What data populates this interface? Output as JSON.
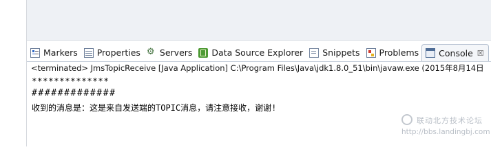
{
  "tabs": [
    {
      "label": "Markers",
      "icon": "markers-icon"
    },
    {
      "label": "Properties",
      "icon": "properties-icon"
    },
    {
      "label": "Servers",
      "icon": "servers-icon"
    },
    {
      "label": "Data Source Explorer",
      "icon": "data-source-explorer-icon"
    },
    {
      "label": "Snippets",
      "icon": "snippets-icon"
    },
    {
      "label": "Problems",
      "icon": "problems-icon"
    },
    {
      "label": "Console",
      "icon": "console-icon",
      "active": true,
      "close": "☒"
    }
  ],
  "console": {
    "status": "<terminated> JmsTopicReceive [Java Application] C:\\Program Files\\Java\\jdk1.8.0_51\\bin\\javaw.exe (2015年8月14日",
    "lines": [
      "**************",
      "#############",
      "收到的消息是：这是来自发送端的TOPIC消息，请注意接收，谢谢!"
    ]
  },
  "watermark": {
    "name": "联动北方技术论坛",
    "url": "http://bbs.landingbj.com"
  },
  "colors": {
    "tab_border": "#b3bfcf",
    "editor_bg": "#eef1f5",
    "watermark": "#b9bfc7"
  }
}
